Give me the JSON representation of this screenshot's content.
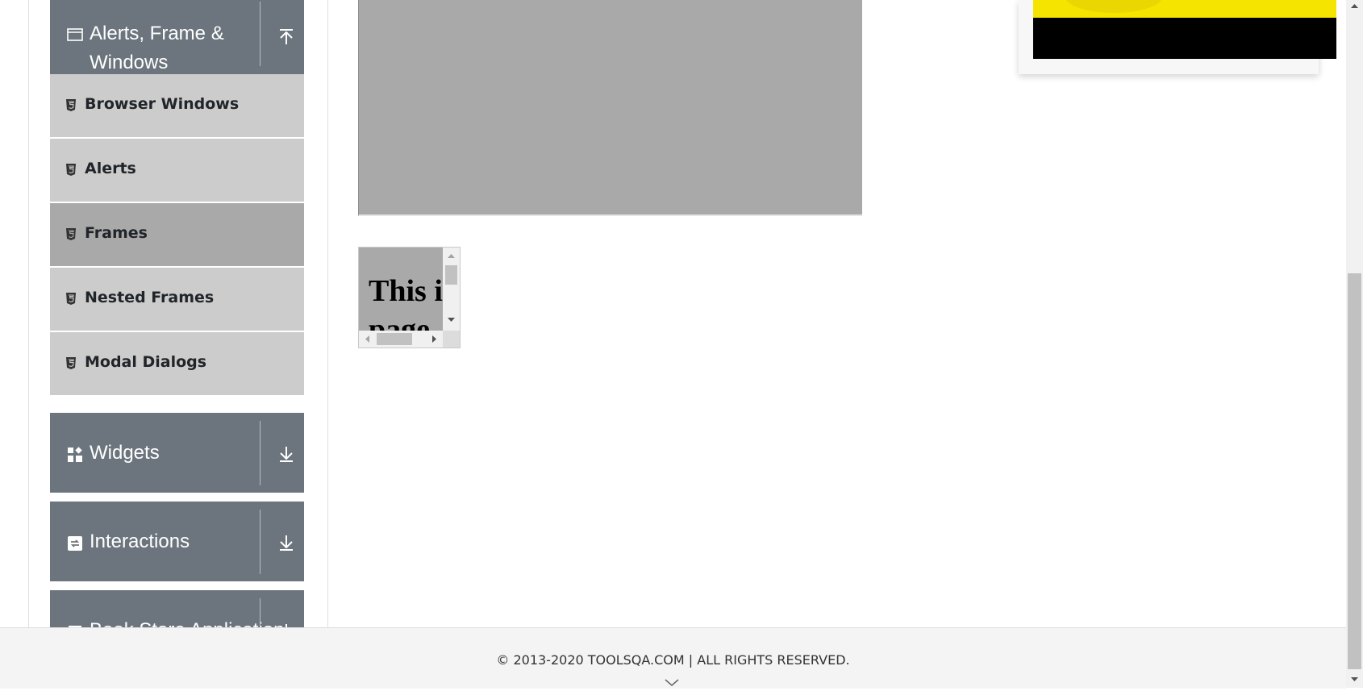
{
  "sidebar": {
    "alerts_group": {
      "title": "Alerts, Frame & Windows"
    },
    "items": [
      {
        "label": "Browser Windows"
      },
      {
        "label": "Alerts"
      },
      {
        "label": "Frames"
      },
      {
        "label": "Nested Frames"
      },
      {
        "label": "Modal Dialogs"
      }
    ],
    "widgets_group": {
      "title": "Widgets"
    },
    "interactions_group": {
      "title": "Interactions"
    },
    "bookstore_group": {
      "title": "Book Store Application"
    }
  },
  "main": {
    "small_frame_text": "This is a sample page"
  },
  "footer": {
    "copyright": "© 2013-2020 TOOLSQA.COM | ALL RIGHTS RESERVED."
  },
  "colors": {
    "group_header": "#6c757d",
    "menu_item": "#cccccc",
    "menu_item_active": "#a9a9a9",
    "frame_bg": "#a9a9a9"
  }
}
